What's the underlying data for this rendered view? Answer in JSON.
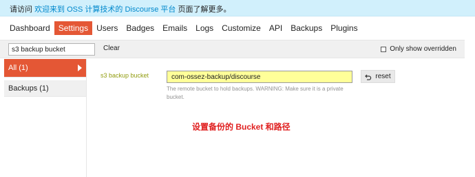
{
  "notice": {
    "prefix": "请访问 ",
    "link": "欢迎来到 OSS 计算技术的 Discourse 平台",
    "suffix": " 页面了解更多。"
  },
  "nav": {
    "items": [
      {
        "label": "Dashboard",
        "active": false
      },
      {
        "label": "Settings",
        "active": true
      },
      {
        "label": "Users",
        "active": false
      },
      {
        "label": "Badges",
        "active": false
      },
      {
        "label": "Emails",
        "active": false
      },
      {
        "label": "Logs",
        "active": false
      },
      {
        "label": "Customize",
        "active": false
      },
      {
        "label": "API",
        "active": false
      },
      {
        "label": "Backups",
        "active": false
      },
      {
        "label": "Plugins",
        "active": false
      }
    ]
  },
  "filter": {
    "value": "s3 backup bucket",
    "clear_label": "Clear",
    "only_overridden_label": "Only show overridden"
  },
  "sidebar": {
    "items": [
      {
        "label": "All",
        "count": "(1)",
        "active": true
      },
      {
        "label": "Backups",
        "count": "(1)",
        "active": false
      }
    ]
  },
  "setting": {
    "label": "s3 backup bucket",
    "value": "com-ossez-backup/discourse",
    "reset_label": "reset",
    "description": "The remote bucket to hold backups. WARNING: Make sure it is a private bucket."
  },
  "annotation": "设置备份的 Bucket 和路径",
  "colors": {
    "accent": "#e45735",
    "notice_bg": "#d1f0fc",
    "link": "#0088cc",
    "setting_label": "#919c0f",
    "input_highlight": "#ffff99",
    "annotation": "#e02020"
  }
}
